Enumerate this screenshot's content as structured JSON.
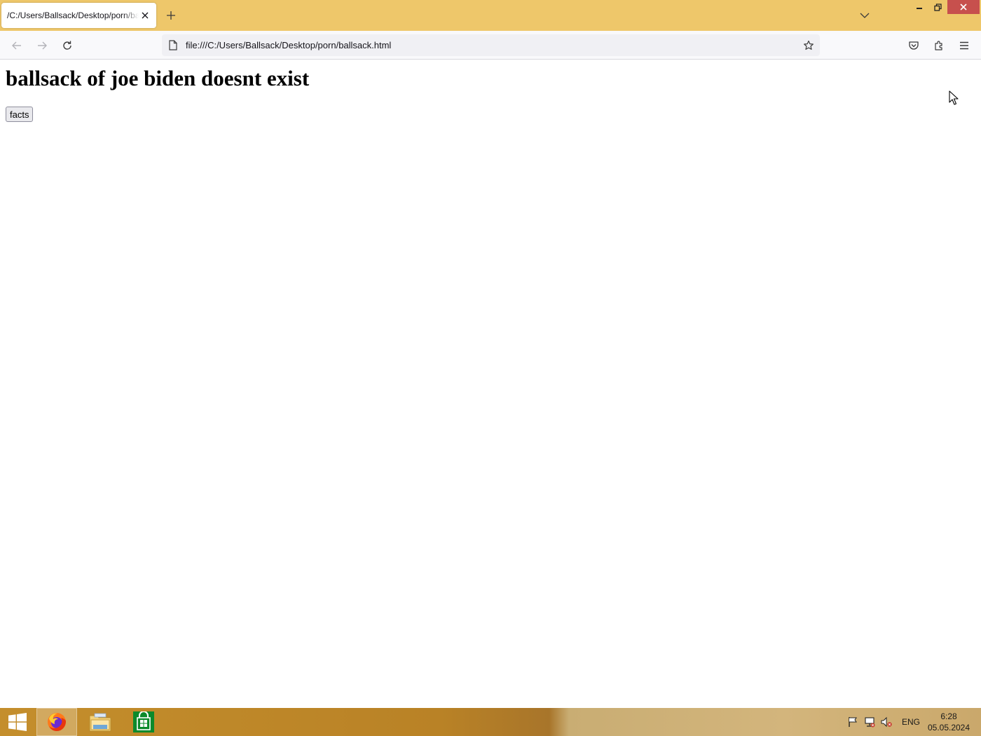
{
  "browser": {
    "tab": {
      "title": "/C:/Users/Ballsack/Desktop/porn/ballsack.html"
    },
    "url": "file:///C:/Users/Ballsack/Desktop/porn/ballsack.html"
  },
  "page": {
    "heading": "ballsack of joe biden doesnt exist",
    "button_label": "facts"
  },
  "taskbar": {
    "language": "ENG",
    "time": "6:28",
    "date": "05.05.2024"
  },
  "colors": {
    "titlebar": "#eec76a",
    "close_button": "#c7504d",
    "taskbar": "#b98226"
  },
  "icons": [
    "close-icon",
    "plus-icon",
    "chevron-down-icon",
    "minimize-icon",
    "restore-icon",
    "back-arrow-icon",
    "forward-arrow-icon",
    "reload-icon",
    "page-icon",
    "star-icon",
    "pocket-icon",
    "extensions-icon",
    "menu-icon",
    "windows-logo-icon",
    "firefox-icon",
    "file-explorer-icon",
    "store-icon",
    "flag-icon",
    "network-icon",
    "volume-muted-icon",
    "mouse-cursor-icon"
  ]
}
